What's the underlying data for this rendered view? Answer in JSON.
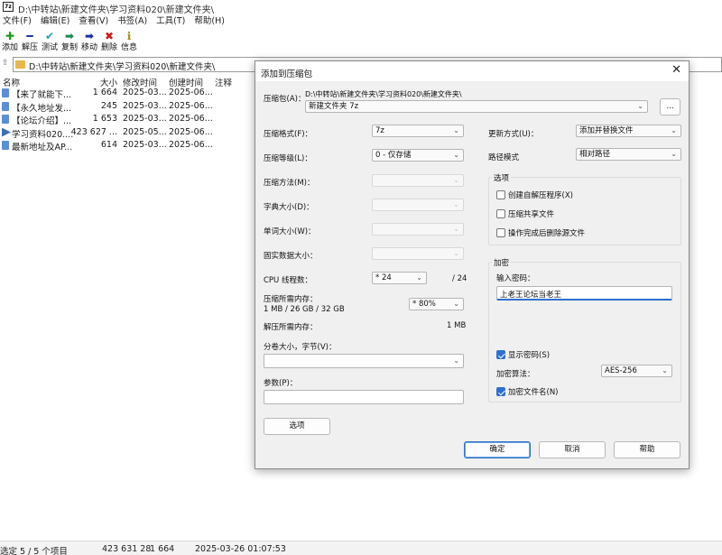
{
  "app": {
    "icon_text": "7z",
    "title": "D:\\中转站\\新建文件夹\\学习资料020\\新建文件夹\\"
  },
  "menu": [
    "文件(F)",
    "编辑(E)",
    "查看(V)",
    "书签(A)",
    "工具(T)",
    "帮助(H)"
  ],
  "toolbar": [
    {
      "label": "添加",
      "icon": "plus-icon",
      "glyph": "✚",
      "color": "#1a9b1a"
    },
    {
      "label": "解压",
      "icon": "minus-icon",
      "glyph": "━",
      "color": "#1d2fa8"
    },
    {
      "label": "测试",
      "icon": "check-down-icon",
      "glyph": "✔",
      "color": "#1aa3b5"
    },
    {
      "label": "复制",
      "icon": "copy-arrow-icon",
      "glyph": "➡",
      "color": "#1a8a4a"
    },
    {
      "label": "移动",
      "icon": "move-arrow-icon",
      "glyph": "➡",
      "color": "#1d2fa8"
    },
    {
      "label": "删除",
      "icon": "delete-x-icon",
      "glyph": "✖",
      "color": "#d01a1a"
    },
    {
      "label": "信息",
      "icon": "info-icon",
      "glyph": "ℹ",
      "color": "#b08a10"
    }
  ],
  "address": {
    "path": "D:\\中转站\\新建文件夹\\学习资料020\\新建文件夹\\"
  },
  "file_list": {
    "columns": {
      "name": "名称",
      "size": "大小",
      "modified": "修改时间",
      "created": "创建时间",
      "comment": "注释"
    },
    "rows": [
      {
        "name": "【来了就能下...",
        "size": "1 664",
        "modified": "2025-03...",
        "created": "2025-06...",
        "type": "doc"
      },
      {
        "name": "【永久地址发...",
        "size": "245",
        "modified": "2025-03...",
        "created": "2025-06...",
        "type": "doc"
      },
      {
        "name": "【论坛介绍】...",
        "size": "1 653",
        "modified": "2025-03...",
        "created": "2025-06...",
        "type": "doc"
      },
      {
        "name": "学习资料020....",
        "size": "423 627 ...",
        "modified": "2025-05...",
        "created": "2025-06...",
        "type": "exe"
      },
      {
        "name": "最新地址及AP...",
        "size": "614",
        "modified": "2025-03...",
        "created": "2025-06...",
        "type": "doc"
      }
    ]
  },
  "status": {
    "selection": "选定 5 / 5 个项目",
    "total_size": "423 631 28",
    "item_size": "1 664",
    "datetime": "2025-03-26 01:07:53"
  },
  "dialog": {
    "title": "添加到压缩包",
    "archive_label": "压缩包(A)：",
    "archive_path": "D:\\中转站\\新建文件夹\\学习资料020\\新建文件夹\\",
    "archive_name": "新建文件夹 7z",
    "browse_label": "...",
    "format_label": "压缩格式(F)：",
    "format_value": "7z",
    "level_label": "压缩等级(L)：",
    "level_value": "0 - 仅存储",
    "method_label": "压缩方法(M)：",
    "dict_label": "字典大小(D)：",
    "word_label": "单词大小(W)：",
    "solid_label": "固实数据大小：",
    "threads_label": "CPU 线程数：",
    "threads_value": "* 24",
    "threads_max": "/ 24",
    "mem_comp_label": "压缩所需内存：",
    "mem_comp_detail": "1 MB / 26 GB / 32 GB",
    "mem_comp_value": "* 80%",
    "mem_decomp_label": "解压所需内存：",
    "mem_decomp_value": "1 MB",
    "volume_label": "分卷大小，字节(V)：",
    "params_label": "参数(P)：",
    "options_btn": "选项",
    "update_label": "更新方式(U)：",
    "update_value": "添加并替换文件",
    "pathmode_label": "路径模式",
    "pathmode_value": "相对路径",
    "options_group": "选项",
    "opt_sfx": "创建自解压程序(X)",
    "opt_shared": "压缩共享文件",
    "opt_delete": "操作完成后删除源文件",
    "enc_group": "加密",
    "pwd_label": "输入密码：",
    "pwd_value": "上老王论坛当老王",
    "show_pwd": "显示密码(S)",
    "enc_method_label": "加密算法：",
    "enc_method_value": "AES-256",
    "enc_names": "加密文件名(N)",
    "ok": "确定",
    "cancel": "取消",
    "help": "帮助"
  }
}
